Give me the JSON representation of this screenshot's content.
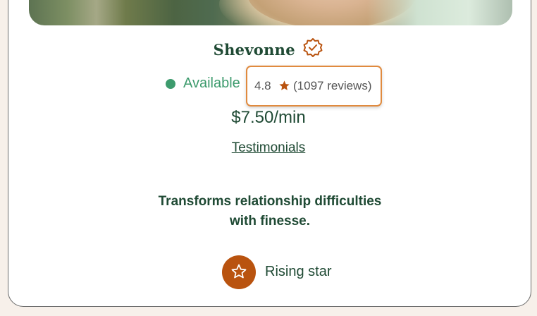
{
  "profile": {
    "name": "Shevonne",
    "verified_icon": "verified-badge-icon",
    "status": "Available",
    "rating": "4.8",
    "rating_icon": "star-icon",
    "reviews": "(1097 reviews)",
    "price": "$7.50/min",
    "testimonials_link": "Testimonials",
    "tagline_line1": "Transforms relationship difficulties",
    "tagline_line2": "with finesse.",
    "badge_icon": "star-outline-icon",
    "badge_label": "Rising star"
  },
  "colors": {
    "primary_text": "#1f4a34",
    "available": "#3d9b6d",
    "accent_orange": "#b9530f",
    "highlight_border": "#e08a3e"
  }
}
